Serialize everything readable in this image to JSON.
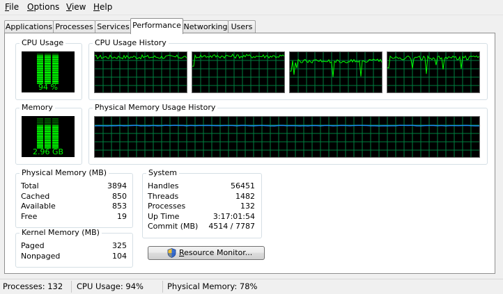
{
  "menu": {
    "file": {
      "accel": "F",
      "rest": "ile"
    },
    "options": {
      "accel": "O",
      "rest": "ptions"
    },
    "view": {
      "accel": "V",
      "rest": "iew"
    },
    "help": {
      "accel": "H",
      "rest": "elp"
    }
  },
  "tabs": [
    "Applications",
    "Processes",
    "Services",
    "Performance",
    "Networking",
    "Users"
  ],
  "active_tab": "Performance",
  "cpu_usage": {
    "title": "CPU Usage",
    "value_text": "94 %",
    "percent": 94
  },
  "cpu_history": {
    "title": "CPU Usage History",
    "core_levels_percent": [
      88,
      90,
      78,
      86
    ]
  },
  "memory": {
    "title": "Memory",
    "value_text": "2.96 GB",
    "percent": 78
  },
  "memory_history": {
    "title": "Physical Memory Usage History",
    "level_percent": 78
  },
  "physical_memory": {
    "title": "Physical Memory (MB)",
    "rows": [
      {
        "label": "Total",
        "value": "3894"
      },
      {
        "label": "Cached",
        "value": "850"
      },
      {
        "label": "Available",
        "value": "853"
      },
      {
        "label": "Free",
        "value": "19"
      }
    ]
  },
  "kernel_memory": {
    "title": "Kernel Memory (MB)",
    "rows": [
      {
        "label": "Paged",
        "value": "325"
      },
      {
        "label": "Nonpaged",
        "value": "104"
      }
    ]
  },
  "system": {
    "title": "System",
    "rows": [
      {
        "label": "Handles",
        "value": "56451"
      },
      {
        "label": "Threads",
        "value": "1482"
      },
      {
        "label": "Processes",
        "value": "132"
      },
      {
        "label": "Up Time",
        "value": "3:17:01:54"
      },
      {
        "label": "Commit (MB)",
        "value": "4514 / 7787"
      }
    ]
  },
  "resource_monitor_button": {
    "accel": "R",
    "rest": "esource Monitor..."
  },
  "status": {
    "processes": "Processes: 132",
    "cpu": "CPU Usage: 94%",
    "memory": "Physical Memory: 78%"
  },
  "colors": {
    "graph_bg": "#000000",
    "grid": "#008040",
    "line_cpu": "#00ff00",
    "line_mem": "#1e90ff",
    "meter_on": "#00ff00",
    "meter_off": "#005500"
  },
  "icons": {
    "shield": "uac-shield-icon"
  }
}
